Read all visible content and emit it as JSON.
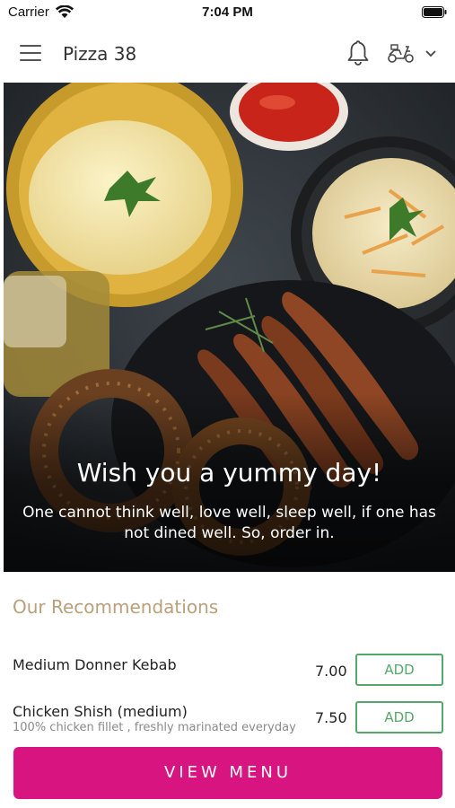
{
  "status_bar": {
    "carrier": "Carrier",
    "time": "7:04 PM"
  },
  "header": {
    "title": "Pizza 38",
    "icons": [
      "menu-icon",
      "bell-icon",
      "scooter-icon",
      "chevron-down-icon"
    ]
  },
  "hero": {
    "title": "Wish you a yummy day!",
    "subtitle": "One cannot think well, love well, sleep well, if one has not dined well. So, order in."
  },
  "recommendations": {
    "title": "Our Recommendations",
    "items": [
      {
        "name": "Medium Donner Kebab",
        "description": "",
        "price": "7.00",
        "add_label": "ADD"
      },
      {
        "name": "Chicken Shish (medium)",
        "description": "100% chicken fillet , freshly marinated everyday",
        "price": "7.50",
        "add_label": "ADD"
      }
    ]
  },
  "footer": {
    "view_menu_label": "VIEW MENU"
  },
  "colors": {
    "accent": "#d7147f",
    "add_button": "#56a76c",
    "section_title": "#b9a07a"
  }
}
